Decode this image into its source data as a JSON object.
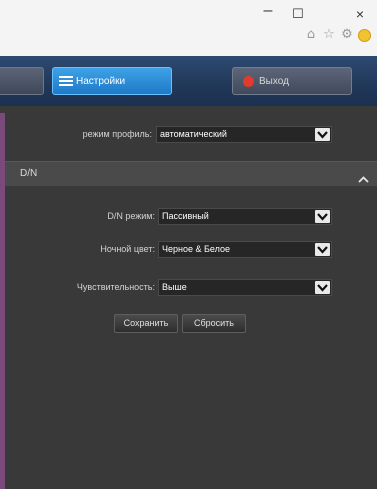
{
  "window": {
    "minimize": "–",
    "maximize": "☐",
    "close": "×"
  },
  "browser_icons": [
    "home-icon",
    "star-icon",
    "gear-icon",
    "smiley-icon"
  ],
  "nav": {
    "settings_label": "Настройки",
    "exit_label": "Выход"
  },
  "profile": {
    "label": "режим профиль:",
    "value": "автоматический"
  },
  "dn_section": {
    "title": "D/N"
  },
  "dn_mode": {
    "label": "D/N режим:",
    "value": "Пассивный"
  },
  "night_color": {
    "label": "Ночной цвет:",
    "value": "Черное & Белое"
  },
  "sensitivity": {
    "label": "Чувствительность:",
    "value": "Выше"
  },
  "buttons": {
    "save": "Сохранить",
    "reset": "Сбросить"
  },
  "colors": {
    "accent": "#2a8ad8",
    "exit_dot": "#e23a2c",
    "panel": "#393939"
  }
}
